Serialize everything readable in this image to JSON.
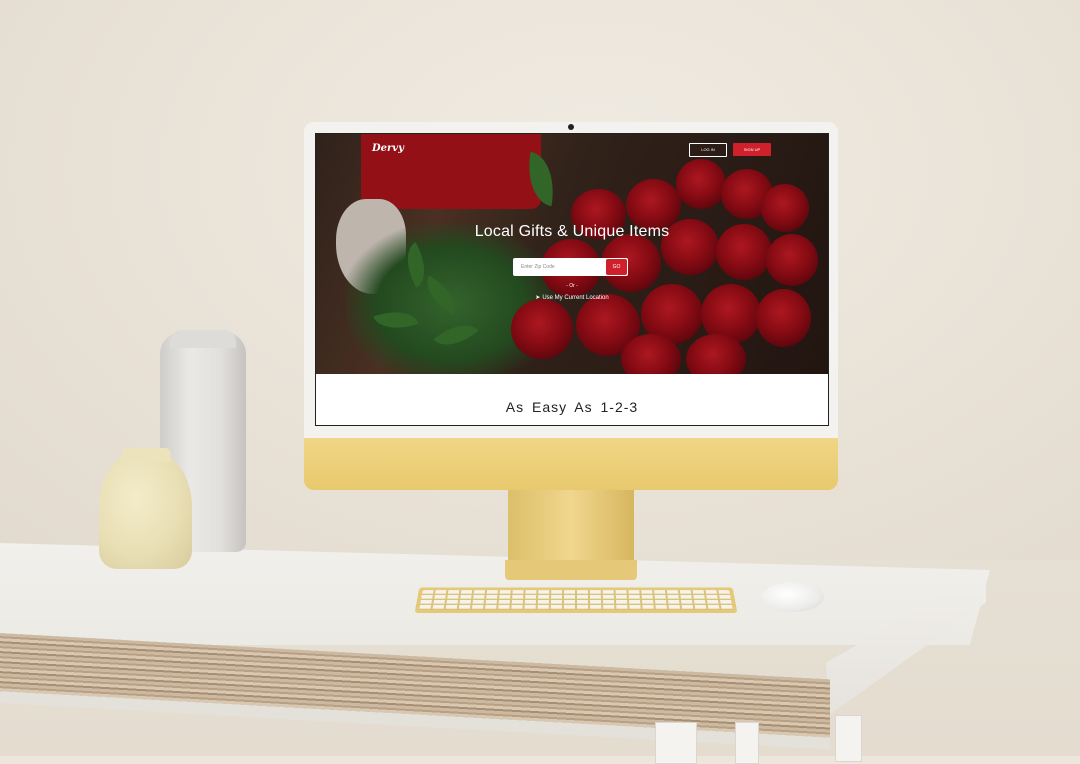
{
  "site": {
    "logo": "Dervy",
    "nav": {
      "login_label": "LOG IN",
      "signup_label": "SIGN UP"
    },
    "hero": {
      "title": "Local Gifts & Unique Items",
      "zip_placeholder": "Enter Zip Code",
      "go_label": "GO",
      "or_text": "- Or -",
      "location_label": "Use My Current Location"
    },
    "section_title": "As Easy As 1-2-3"
  },
  "colors": {
    "accent": "#d0202c",
    "monitor_gold": "#e8c96e",
    "text_dark": "#222222"
  },
  "icons": {
    "location": "location-arrow-icon"
  }
}
